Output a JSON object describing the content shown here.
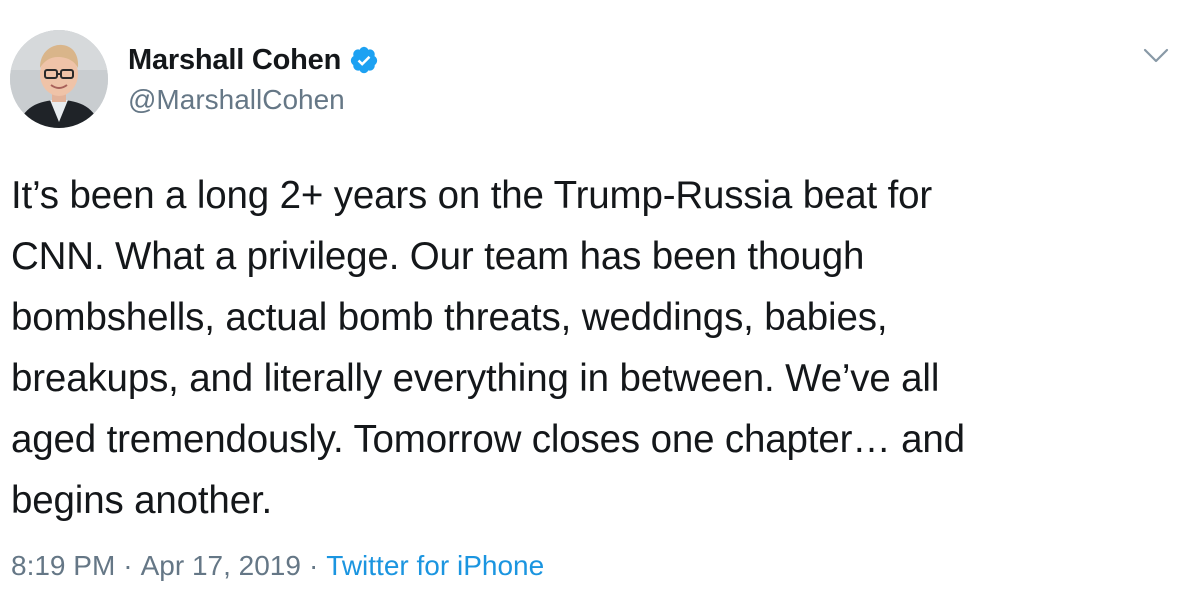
{
  "author": {
    "display_name": "Marshall Cohen",
    "handle": "@MarshallCohen",
    "verified": true
  },
  "tweet": {
    "text": "It’s been a long 2+ years on the Trump-Russia beat for\nCNN. What a privilege. Our team has been though\nbombshells, actual bomb threats, weddings, babies,\nbreakups, and literally everything in between. We’ve all\naged tremendously. Tomorrow closes one chapter… and\nbegins another.",
    "time": "8:19 PM",
    "date": "Apr 17, 2019",
    "separator": "·",
    "source": "Twitter for iPhone"
  },
  "icons": {
    "verified": "verified-badge-icon",
    "menu": "chevron-down-icon"
  },
  "colors": {
    "text": "#14171a",
    "secondary": "#657786",
    "link": "#1b95e0",
    "verified": "#1da1f2"
  }
}
